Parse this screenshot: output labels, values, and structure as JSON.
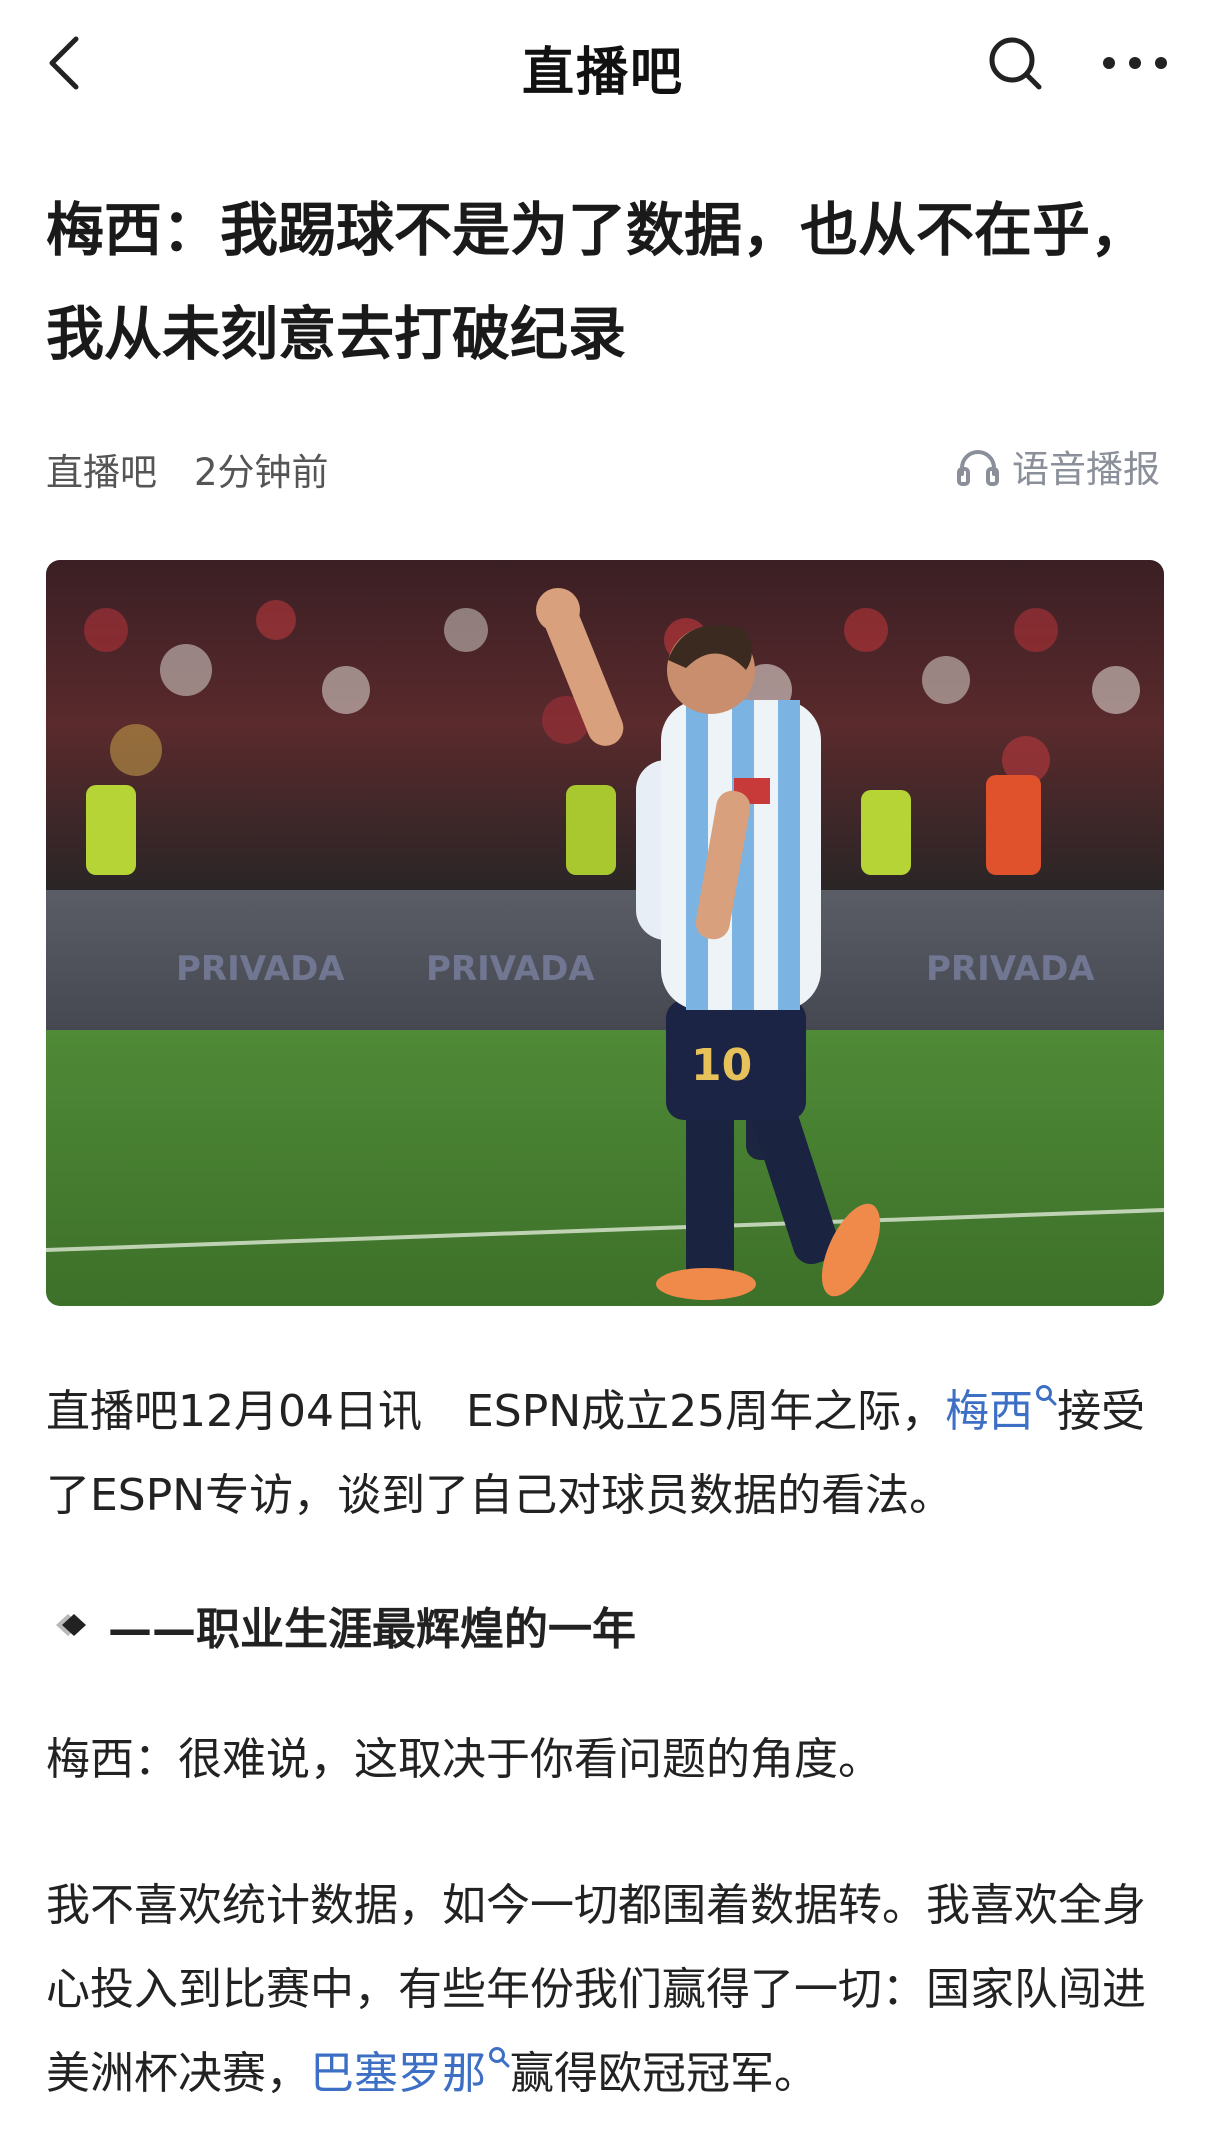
{
  "nav": {
    "title": "直播吧",
    "back_icon": "chevron-left-icon",
    "search_icon": "search-icon",
    "more_icon": "more-dots-icon"
  },
  "article": {
    "title": "梅西：我踢球不是为了数据，也从不在乎，我从未刻意去打破纪录",
    "source": "直播吧",
    "time": "2分钟前",
    "audio_label": "语音播报",
    "audio_icon": "headphones-icon",
    "paragraph1": {
      "before": "直播吧12月04日讯　ESPN成立25周年之际，",
      "link": "梅西",
      "after": "接受了ESPN专访，谈到了自己对球员数据的看法。"
    },
    "subheading": "——职业生涯最辉煌的一年",
    "subheading_icon": "diamond-icon",
    "paragraph2": "梅西：很难说，这取决于你看问题的角度。",
    "paragraph3": {
      "before": "我不喜欢统计数据，如今一切都围着数据转。我喜欢全身心投入到比赛中，有些年份我们赢得了一切：国家队闯进美洲杯决赛，",
      "link": "巴塞罗那",
      "after": "赢得欧冠冠军。"
    },
    "link_search_icon": "search-icon"
  },
  "colors": {
    "link": "#3d6fc4",
    "meta_text": "#555555",
    "audio_text": "#8a8f99",
    "body_text": "#222222"
  }
}
